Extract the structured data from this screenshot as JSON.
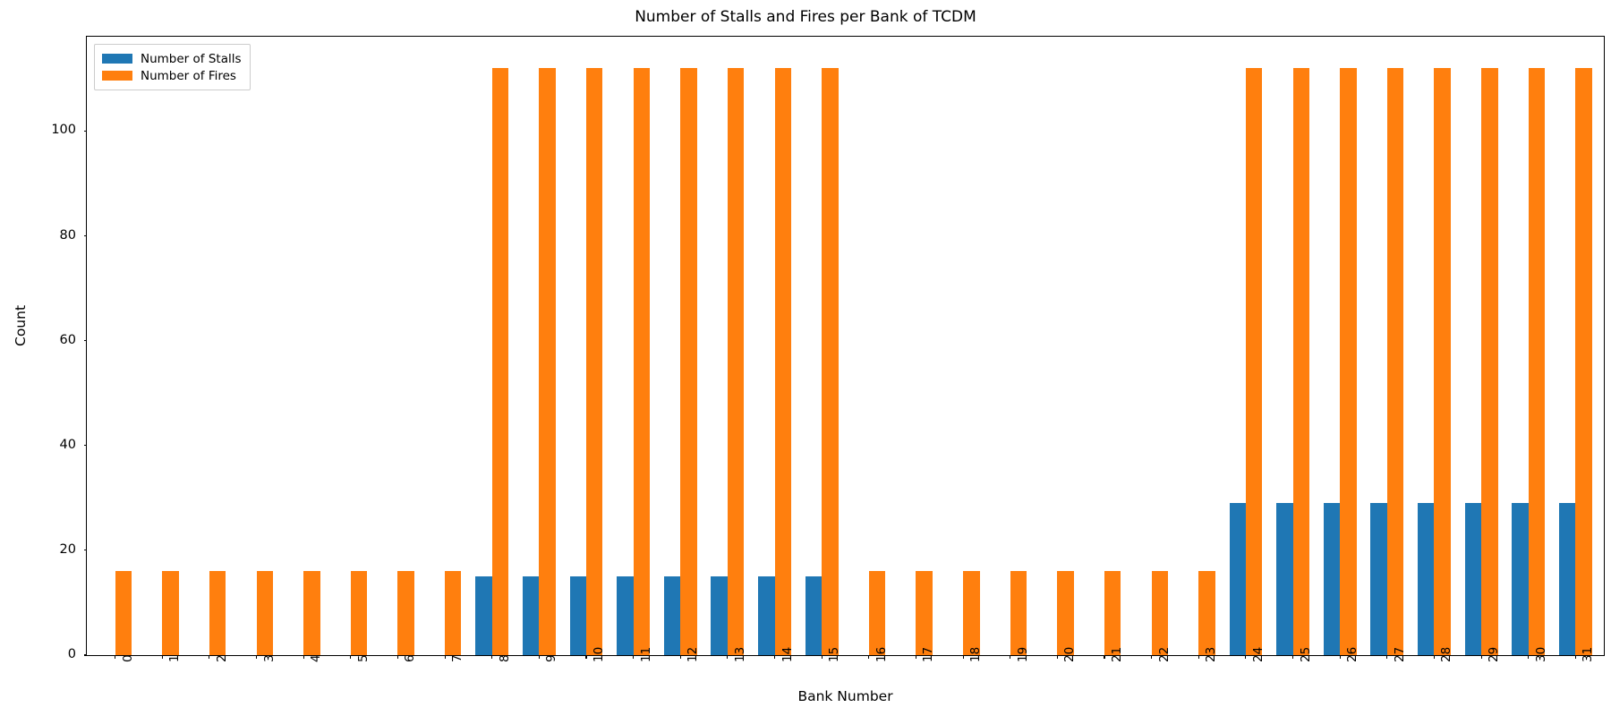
{
  "chart_data": {
    "type": "bar",
    "title": "Number of Stalls and Fires per Bank of TCDM",
    "xlabel": "Bank Number",
    "ylabel": "Count",
    "grid": false,
    "legend_position": "upper left",
    "xlim": [
      -0.6,
      31.6
    ],
    "ylim": [
      0,
      118
    ],
    "ytick_labels": [
      "0",
      "20",
      "40",
      "60",
      "80",
      "100"
    ],
    "ytick_values": [
      0,
      20,
      40,
      60,
      80,
      100
    ],
    "categories": [
      "0",
      "1",
      "2",
      "3",
      "4",
      "5",
      "6",
      "7",
      "8",
      "9",
      "10",
      "11",
      "12",
      "13",
      "14",
      "15",
      "16",
      "17",
      "18",
      "19",
      "20",
      "21",
      "22",
      "23",
      "24",
      "25",
      "26",
      "27",
      "28",
      "29",
      "30",
      "31"
    ],
    "series": [
      {
        "name": "Number of Stalls",
        "color": "#1f77b4",
        "values": [
          0,
          0,
          0,
          0,
          0,
          0,
          0,
          0,
          15,
          15,
          15,
          15,
          15,
          15,
          15,
          15,
          0,
          0,
          0,
          0,
          0,
          0,
          0,
          0,
          29,
          29,
          29,
          29,
          29,
          29,
          29,
          29
        ]
      },
      {
        "name": "Number of Fires",
        "color": "#ff7f0e",
        "values": [
          16,
          16,
          16,
          16,
          16,
          16,
          16,
          16,
          112,
          112,
          112,
          112,
          112,
          112,
          112,
          112,
          16,
          16,
          16,
          16,
          16,
          16,
          16,
          16,
          112,
          112,
          112,
          112,
          112,
          112,
          112,
          112
        ]
      }
    ]
  },
  "legend": {
    "items": [
      {
        "label": "Number of Stalls",
        "color": "#1f77b4"
      },
      {
        "label": "Number of Fires",
        "color": "#ff7f0e"
      }
    ]
  }
}
